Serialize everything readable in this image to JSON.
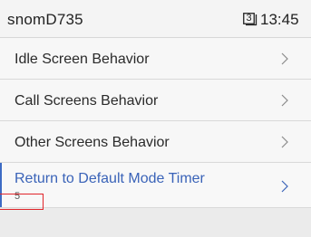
{
  "status_bar": {
    "device_name": "snomD735",
    "line_number": "3",
    "time": "13:45"
  },
  "menu": {
    "items": [
      {
        "label": "Idle Screen Behavior",
        "icon": "chevron-right-icon"
      },
      {
        "label": "Call Screens Behavior",
        "icon": "chevron-right-icon"
      },
      {
        "label": "Other Screens Behavior",
        "icon": "chevron-right-icon"
      },
      {
        "label": "Return to Default Mode Timer",
        "value": "5",
        "icon": "chevron-right-icon",
        "selected": true
      }
    ]
  },
  "colors": {
    "accent": "#3a63b8",
    "highlight": "#e0252a",
    "background": "#ebebeb"
  }
}
